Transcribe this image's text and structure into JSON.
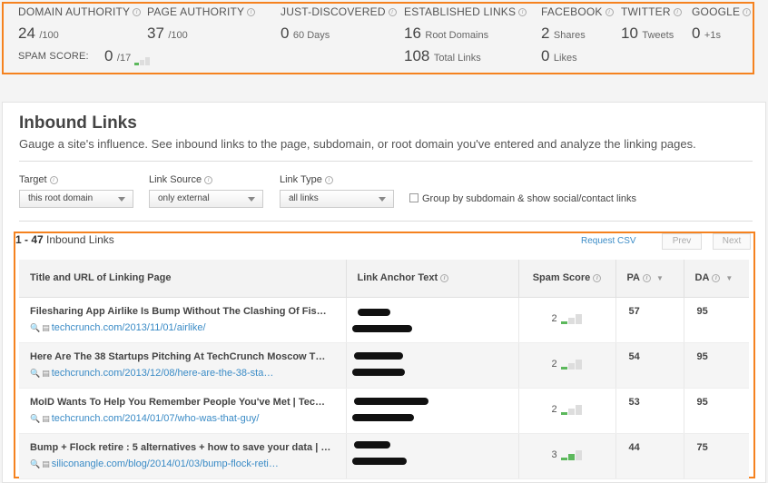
{
  "metrics": {
    "domain_authority": {
      "label": "DOMAIN AUTHORITY",
      "value": "24",
      "unit": "/100"
    },
    "page_authority": {
      "label": "PAGE AUTHORITY",
      "value": "37",
      "unit": "/100"
    },
    "just_discovered": {
      "label": "JUST-DISCOVERED",
      "value": "0",
      "unit": "60 Days"
    },
    "established_links": {
      "label": "ESTABLISHED LINKS",
      "root_value": "16",
      "root_unit": "Root Domains",
      "total_value": "108",
      "total_unit": "Total Links"
    },
    "facebook": {
      "label": "FACEBOOK",
      "shares_value": "2",
      "shares_unit": "Shares",
      "likes_value": "0",
      "likes_unit": "Likes"
    },
    "twitter": {
      "label": "TWITTER",
      "value": "10",
      "unit": "Tweets"
    },
    "google": {
      "label": "GOOGLE",
      "value": "0",
      "unit": "+1s"
    },
    "spam_score": {
      "label": "SPAM SCORE:",
      "value": "0",
      "unit": "/17"
    }
  },
  "section": {
    "title": "Inbound Links",
    "subtitle": "Gauge a site's influence. See inbound links to the page, subdomain, or root domain you've entered and analyze the linking pages."
  },
  "filters": {
    "target": {
      "label": "Target",
      "value": "this root domain"
    },
    "link_source": {
      "label": "Link Source",
      "value": "only external"
    },
    "link_type": {
      "label": "Link Type",
      "value": "all links"
    },
    "group_label": "Group by subdomain & show social/contact links"
  },
  "results": {
    "range": "1 - 47",
    "suffix": "Inbound Links",
    "request_csv": "Request CSV",
    "prev": "Prev",
    "next": "Next"
  },
  "table": {
    "headers": [
      "Title and URL of Linking Page",
      "Link Anchor Text",
      "Spam Score",
      "PA",
      "DA"
    ],
    "rows": [
      {
        "title": "Filesharing App Airlike Is Bump Without The Clashing Of Fis…",
        "url": "techcrunch.com/2013/11/01/airlike/",
        "spam": "2",
        "pa": "57",
        "da": "95"
      },
      {
        "title": "Here Are The 38 Startups Pitching At TechCrunch Moscow T…",
        "url": "techcrunch.com/2013/12/08/here-are-the-38-sta…",
        "spam": "2",
        "pa": "54",
        "da": "95"
      },
      {
        "title": "MoID Wants To Help You Remember People You've Met | Tec…",
        "url": "techcrunch.com/2014/01/07/who-was-that-guy/",
        "spam": "2",
        "pa": "53",
        "da": "95"
      },
      {
        "title": "Bump + Flock retire : 5 alternatives + how to save your data | …",
        "url": "siliconangle.com/blog/2014/01/03/bump-flock-reti…",
        "spam": "3",
        "pa": "44",
        "da": "75"
      }
    ]
  },
  "colors": {
    "accent": "#f5821f",
    "link": "#3a8bc6",
    "spam_green": "#5cb85c"
  }
}
